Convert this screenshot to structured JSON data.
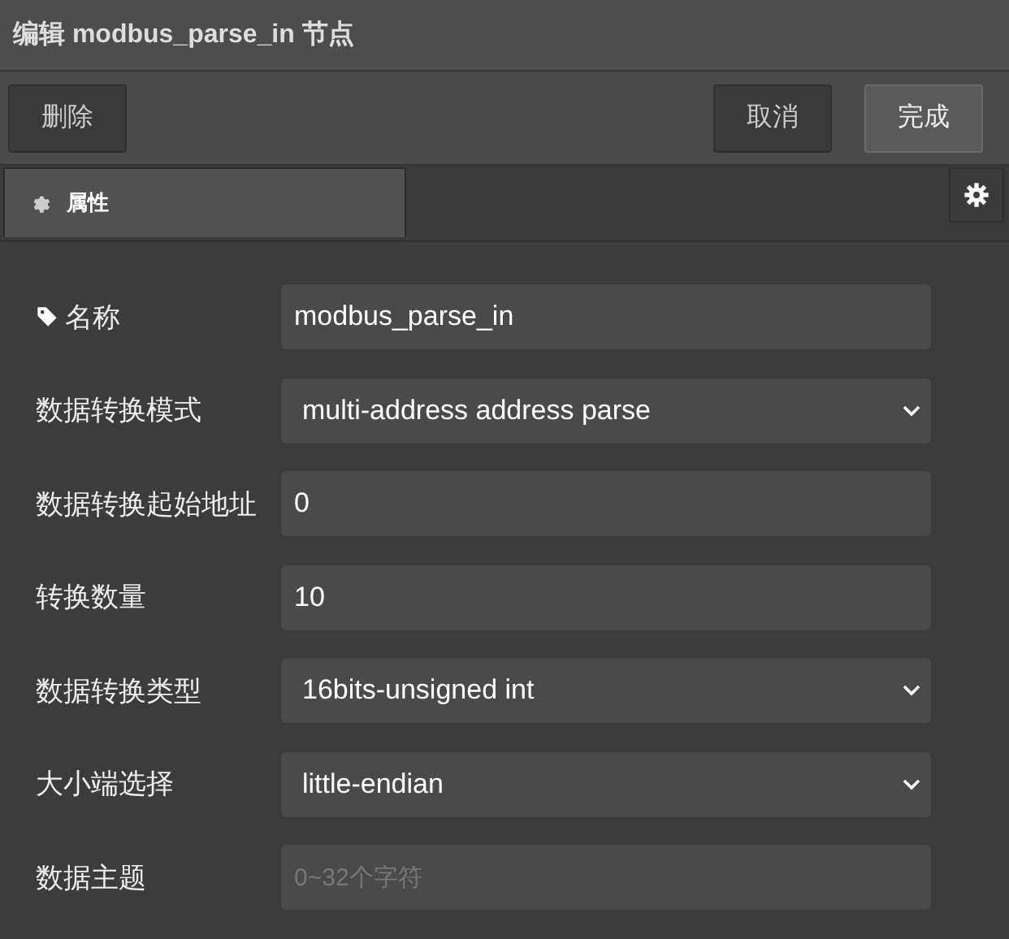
{
  "window": {
    "title": "编辑 modbus_parse_in 节点"
  },
  "toolbar": {
    "left_buttons": [
      "删除"
    ],
    "right_buttons": [
      {
        "label": "取消",
        "kind": "secondary"
      },
      {
        "label": "完成",
        "kind": "primary"
      }
    ]
  },
  "tabs": [
    {
      "label": "属性",
      "selected": true
    }
  ],
  "form": {
    "rows": [
      {
        "label": "名称",
        "kind": "text",
        "value": "modbus_parse_in"
      },
      {
        "label": "数据转换模式",
        "kind": "select",
        "value": "multi-address address parse"
      },
      {
        "label": "数据转换起始地址",
        "kind": "text",
        "value": "0"
      },
      {
        "label": "转换数量",
        "kind": "text",
        "value": "10"
      },
      {
        "label": "数据转换类型",
        "kind": "select",
        "value": "16bits-unsigned int"
      },
      {
        "label": "大小端选择",
        "kind": "select",
        "value": "little-endian"
      },
      {
        "label": "数据主题",
        "kind": "text",
        "placeholder": "0~32个字符"
      }
    ]
  }
}
